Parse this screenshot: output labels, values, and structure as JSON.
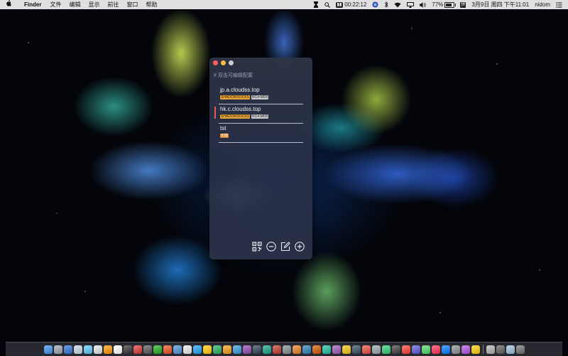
{
  "menubar": {
    "apple_icon": "apple-logo-icon",
    "app_name": "Finder",
    "menus": [
      "文件",
      "编辑",
      "显示",
      "前往",
      "窗口",
      "帮助"
    ],
    "status": {
      "timer": "00:22:12",
      "battery_percent": "77%",
      "battery_level": 0.77,
      "ime": "拼",
      "datetime": "3月9日 周四 下午11:01",
      "user": "nidom"
    }
  },
  "window": {
    "hint": "# 双击可编辑配置",
    "servers": [
      {
        "host": "jp.a.cloudss.top",
        "protocol": "SHADOWSOCKS",
        "method": "RC4-MD5",
        "active": false
      },
      {
        "host": "hk.c.cloudss.top",
        "protocol": "SHADOWSOCKS",
        "method": "RC4-MD5",
        "active": true
      },
      {
        "host": "tst",
        "status": "无效"
      }
    ],
    "toolbar": [
      "qr-code-icon",
      "remove-icon",
      "edit-icon",
      "add-icon"
    ]
  },
  "colors": {
    "accent_active": "#e85a4f",
    "tag_protocol": "#e7a53c",
    "tag_method": "#c9c9c9"
  },
  "dock": {
    "icon_colors": [
      "#3b8ef0",
      "#9aa3ad",
      "#2d6fd6",
      "#c9d6e6",
      "#5ac8fa",
      "#e5e5e5",
      "#ff9500",
      "#ffffff",
      "#2f2f2f",
      "#d33",
      "#555",
      "#1aad19",
      "#e94e1b",
      "#4a90d9",
      "#e9e9e9",
      "#1da1f2",
      "#ffcc00",
      "#27ae60",
      "#f39c12",
      "#3498db",
      "#8e44ad",
      "#2c3e50",
      "#16a085",
      "#c0392b",
      "#7f8c8d",
      "#e67e22",
      "#2980b9",
      "#d35400",
      "#1abc9c",
      "#9b59b6",
      "#f1c40f",
      "#34495e",
      "#e74c3c",
      "#95a5a6",
      "#2ecc71",
      "#3d3d3d",
      "#ff3b30",
      "#5856d6",
      "#4cd964",
      "#ff2d55",
      "#007aff",
      "#8e8e93",
      "#af52de",
      "#ffcc00",
      "#b0b0b0",
      "#5a5a5a",
      "#9bbcd8",
      "#6e6e6e"
    ]
  }
}
